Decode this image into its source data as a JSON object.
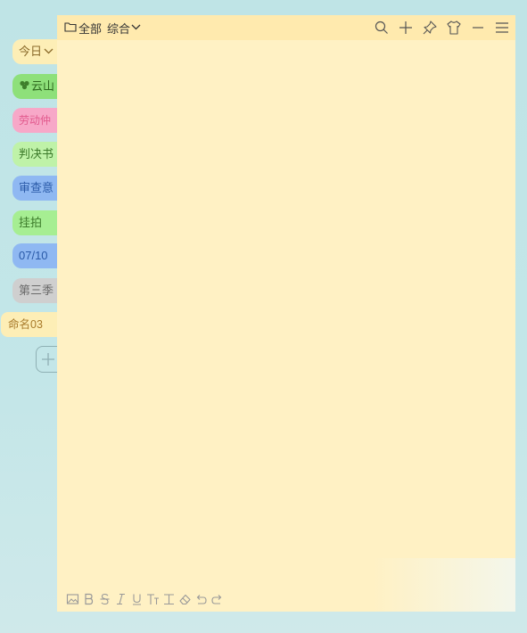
{
  "sidebar": {
    "today_label": "今日",
    "tabs": [
      {
        "label": "云山"
      },
      {
        "label": "劳动仲"
      },
      {
        "label": "判决书"
      },
      {
        "label": "审查意"
      },
      {
        "label": "挂拍"
      },
      {
        "label": "07/10"
      },
      {
        "label": "第三季"
      },
      {
        "label": "命名03"
      }
    ]
  },
  "note": {
    "folder_label": "全部",
    "category_label": "综合",
    "body_text": ""
  },
  "icons": {
    "top": [
      "search-icon",
      "plus-icon",
      "pin-icon",
      "shirt-icon",
      "minimize-icon",
      "menu-icon"
    ],
    "bottom": [
      "image-icon",
      "bold-icon",
      "strikethrough-icon",
      "italic-icon",
      "underline-icon",
      "subscript-icon",
      "text-height-icon",
      "eraser-icon",
      "undo-icon",
      "redo-icon"
    ]
  },
  "colors": {
    "note_bg": "#fff1c4",
    "note_topbar": "#ffeaae",
    "background": "#bfe4e6"
  }
}
